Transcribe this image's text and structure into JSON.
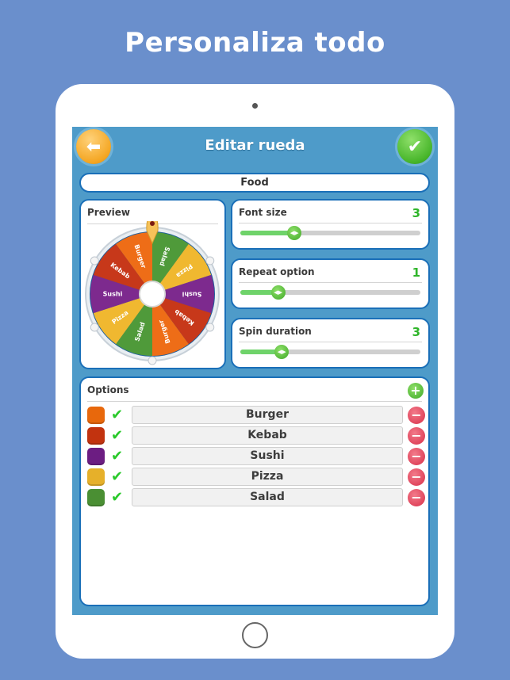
{
  "promo": {
    "title": "Personaliza todo"
  },
  "header": {
    "title": "Editar rueda",
    "back_icon": "arrow-left-icon",
    "confirm_icon": "checkmark-icon"
  },
  "wheel_name": "Food",
  "preview": {
    "label": "Preview",
    "segments": [
      {
        "label": "Salad",
        "color": "#4f9a3a"
      },
      {
        "label": "Pizza",
        "color": "#f0b830"
      },
      {
        "label": "Sushi",
        "color": "#7d2a8e"
      },
      {
        "label": "Kebab",
        "color": "#c7381a"
      },
      {
        "label": "Burger",
        "color": "#ee6d17"
      },
      {
        "label": "Salad",
        "color": "#4f9a3a"
      },
      {
        "label": "Pizza",
        "color": "#f0b830"
      },
      {
        "label": "Sushi",
        "color": "#7d2a8e"
      },
      {
        "label": "Kebab",
        "color": "#c7381a"
      },
      {
        "label": "Burger",
        "color": "#ee6d17"
      }
    ]
  },
  "settings": [
    {
      "label": "Font size",
      "value": "3",
      "fraction": 0.3
    },
    {
      "label": "Repeat option",
      "value": "1",
      "fraction": 0.21
    },
    {
      "label": "Spin duration",
      "value": "3",
      "fraction": 0.23
    }
  ],
  "options": {
    "label": "Options",
    "add_icon": "plus-icon",
    "items": [
      {
        "name": "Burger",
        "color": "#e8680c",
        "enabled": true
      },
      {
        "name": "Kebab",
        "color": "#c2330f",
        "enabled": true
      },
      {
        "name": "Sushi",
        "color": "#6c1d82",
        "enabled": true
      },
      {
        "name": "Pizza",
        "color": "#e6b02a",
        "enabled": true
      },
      {
        "name": "Salad",
        "color": "#4a8f33",
        "enabled": true
      }
    ]
  },
  "colors": {
    "background": "#6a8fcc",
    "screen": "#4e9bc9",
    "panel_border": "#1a6fb8",
    "accent_green": "#2fb52a",
    "remove_red": "#d9304a",
    "back_orange": "#f4a623"
  }
}
